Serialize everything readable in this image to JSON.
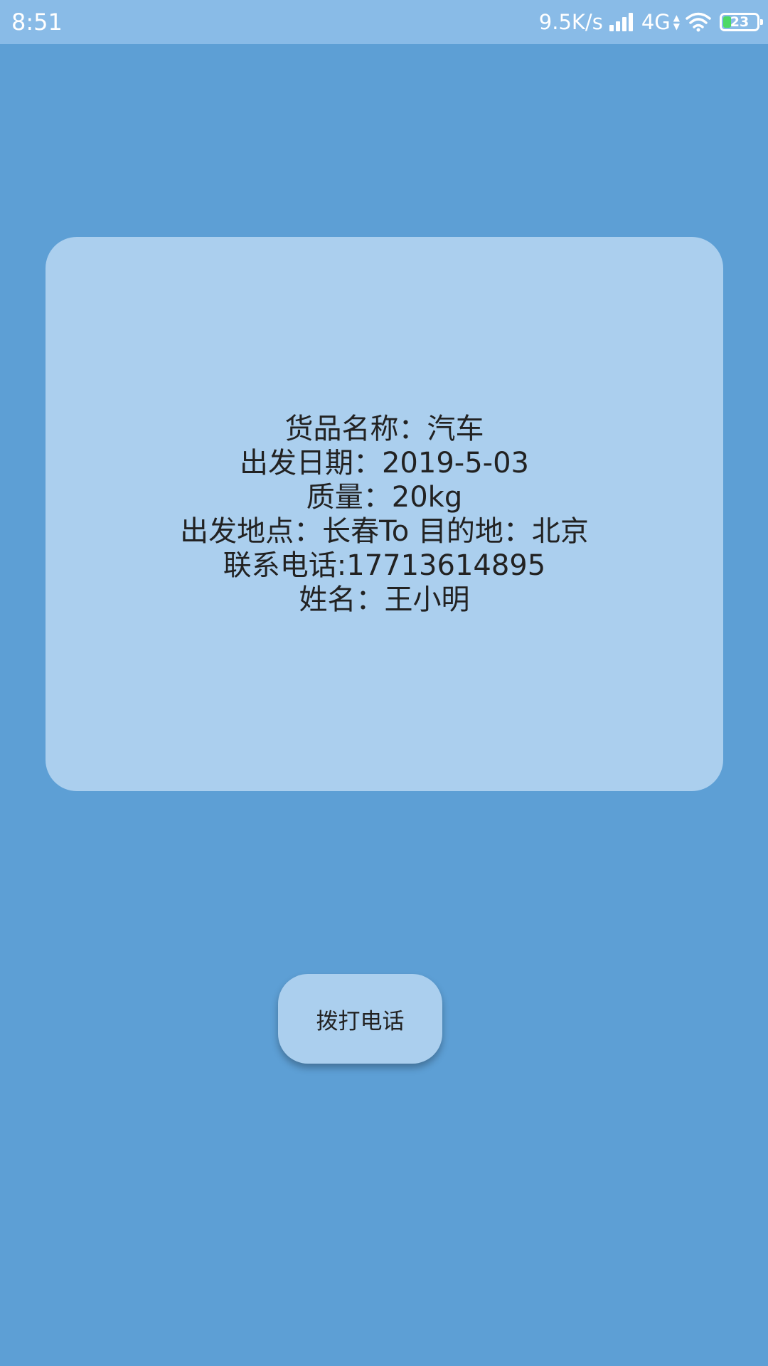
{
  "status_bar": {
    "time": "8:51",
    "net_speed": "9.5K/s",
    "network_type": "4G",
    "battery_level": "23",
    "battery_color": "#4cd964",
    "icons": [
      "signal-icon",
      "updown-arrows-icon",
      "wifi-icon",
      "battery-icon"
    ]
  },
  "shipment": {
    "line1": "货品名称：汽车",
    "line2": "出发日期：2019-5-03",
    "line3": "质量：20kg",
    "line4": "出发地点：长春To 目的地：北京",
    "line5": "联系电话:17713614895",
    "line6": "姓名：王小明"
  },
  "actions": {
    "call_label": "拨打电话"
  },
  "colors": {
    "background": "#5d9fd5",
    "status_bar": "#89bbe7",
    "card": "#abcfee",
    "text": "#222222"
  }
}
